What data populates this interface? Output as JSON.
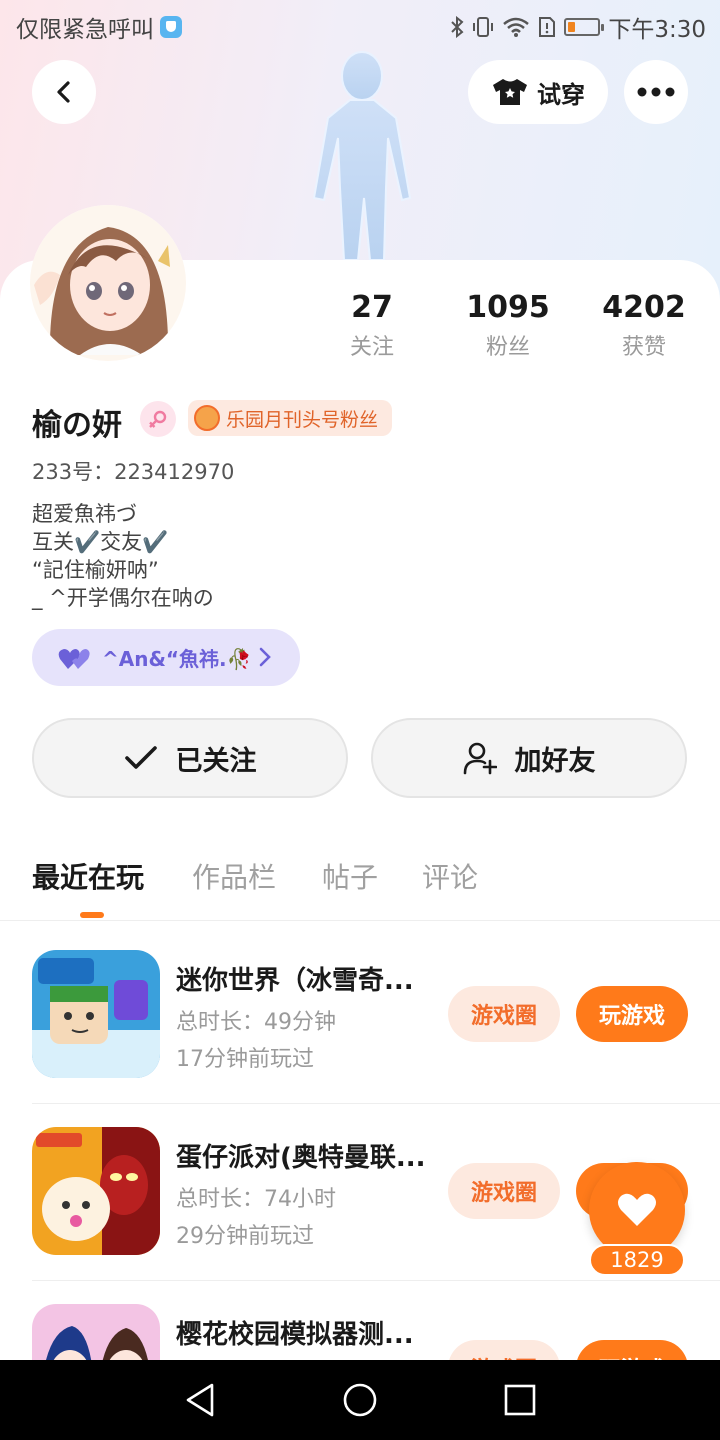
{
  "status_bar": {
    "left_text": "仅限紧急呼叫",
    "time": "下午3:30",
    "battery_level": 0.25
  },
  "header": {
    "try_on_label": "试穿"
  },
  "stats": [
    {
      "value": "27",
      "label": "关注"
    },
    {
      "value": "1095",
      "label": "粉丝"
    },
    {
      "value": "4202",
      "label": "获赞"
    }
  ],
  "profile": {
    "name": "榆の妍",
    "badge": "乐园月刊头号粉丝",
    "uid": "233号：223412970",
    "bio": [
      "超爱魚祎づ",
      "互关✔️交友✔️",
      "“記住榆妍呐”",
      "_ ^开学偶尔在呐の"
    ],
    "club": "^An&“魚祎.🥀"
  },
  "actions": {
    "following": "已关注",
    "add_friend": "加好友"
  },
  "tabs": [
    "最近在玩",
    "作品栏",
    "帖子",
    "评论"
  ],
  "games": [
    {
      "title": "迷你世界（冰雪奇...",
      "duration": "总时长：49分钟",
      "last_played": "17分钟前玩过",
      "circle": "游戏圈",
      "play": "玩游戏"
    },
    {
      "title": "蛋仔派对(奥特曼联...",
      "duration": "总时长：74小时",
      "last_played": "29分钟前玩过",
      "circle": "游戏圈",
      "play": "玩游戏"
    },
    {
      "title": "樱花校园模拟器测...",
      "duration": "",
      "last_played": "",
      "circle": "游戏圈",
      "play": "玩游戏"
    }
  ],
  "like_count": "1829",
  "colors": {
    "accent": "#ff7a1a",
    "badge_bg": "#fde9e0",
    "club_bg": "#e6e3fb"
  }
}
